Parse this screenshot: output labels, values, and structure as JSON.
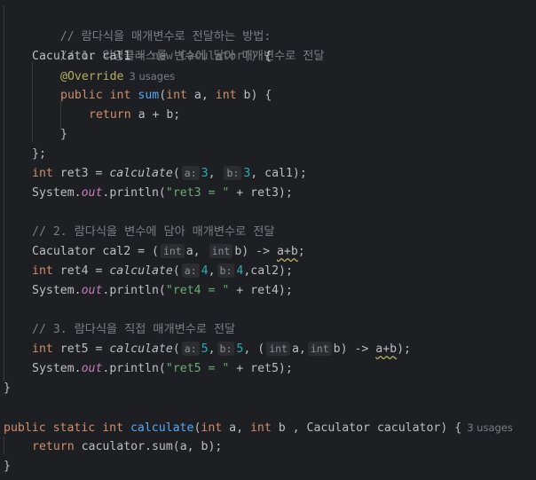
{
  "lines": {
    "l1": {
      "comment": "// 람다식을 매개변수로 전달하는 방법:"
    },
    "l2": {
      "comment": "// 1. 익명클래스를 변수에 담아 매개변수로 전달"
    },
    "l3": {
      "type": "Caculator",
      "name": "cal1",
      "eq": " = ",
      "new_kw": "new",
      "ctor": " Caculator() ",
      "brace": "{"
    },
    "l4": {
      "annotation": "@Override",
      "usages": "3 usages"
    },
    "l5": {
      "public": "public",
      "int": "int",
      "fn": "sum",
      "params_open": "(",
      "int2": "int",
      "a": " a, ",
      "int3": "int",
      "b": " b) {"
    },
    "l6": {
      "return": "return",
      "expr": " a + b;"
    },
    "l7": {
      "text": "}"
    },
    "l8": {
      "text": "};"
    },
    "l9": {
      "int": "int",
      "decl": " ret3 = ",
      "call": "calculate",
      "open": "(",
      "hint_a": "a:",
      "val_a": "3",
      "comma": ", ",
      "hint_b": "b:",
      "val_b": "3",
      "rest": ", cal1);"
    },
    "l10": {
      "sys": "System.",
      "out": "out",
      "println": ".println(",
      "str": "\"ret3 = \"",
      "rest": " + ret3);"
    },
    "l12": {
      "comment": "// 2. 람다식을 변수에 담아 매개변수로 전달"
    },
    "l13": {
      "type": "Caculator",
      "decl": " cal2 = (",
      "hint_int1": "int",
      "a": "a, ",
      "hint_int2": "int",
      "b": "b) -> ",
      "expr": "a+b",
      "semi": ";"
    },
    "l14": {
      "int": "int",
      "decl": " ret4 = ",
      "call": "calculate",
      "open": "(",
      "hint_a": "a:",
      "val_a": "4",
      "comma": ",",
      "hint_b": "b:",
      "val_b": "4",
      "rest": ",cal2);"
    },
    "l15": {
      "sys": "System.",
      "out": "out",
      "println": ".println(",
      "str": "\"ret4 = \"",
      "rest": " + ret4);"
    },
    "l17": {
      "comment": "// 3. 람다식을 직접 매개변수로 전달"
    },
    "l18": {
      "int": "int",
      "decl": " ret5 = ",
      "call": "calculate",
      "open": "(",
      "hint_a": "a:",
      "val_a": "5",
      "comma": ",",
      "hint_b": "b:",
      "val_b": "5",
      "mid": ", (",
      "hint_int1": "int",
      "a": "a,",
      "hint_int2": "int",
      "b": "b) -> ",
      "expr": "a+b",
      "rest": ");"
    },
    "l19": {
      "sys": "System.",
      "out": "out",
      "println": ".println(",
      "str": "\"ret5 = \"",
      "rest": " + ret5);"
    },
    "l20": {
      "text": "}"
    },
    "l22": {
      "public": "public",
      "static": "static",
      "int": "int",
      "fn": "calculate",
      "open": "(",
      "int2": "int",
      "a": " a, ",
      "int3": "int",
      "b": " b , Caculator caculator) {",
      "usages": "3 usages"
    },
    "l23": {
      "return": "return",
      "expr": " caculator.sum(a, b);"
    },
    "l24": {
      "text": "}"
    }
  },
  "colors": {
    "background": "#1e1f22",
    "keyword": "#cf8e6d",
    "function": "#56a8f5",
    "string": "#6aab73",
    "number": "#2aacb8",
    "comment": "#7a7e85",
    "annotation": "#b3ae60",
    "field": "#c77dbb"
  }
}
